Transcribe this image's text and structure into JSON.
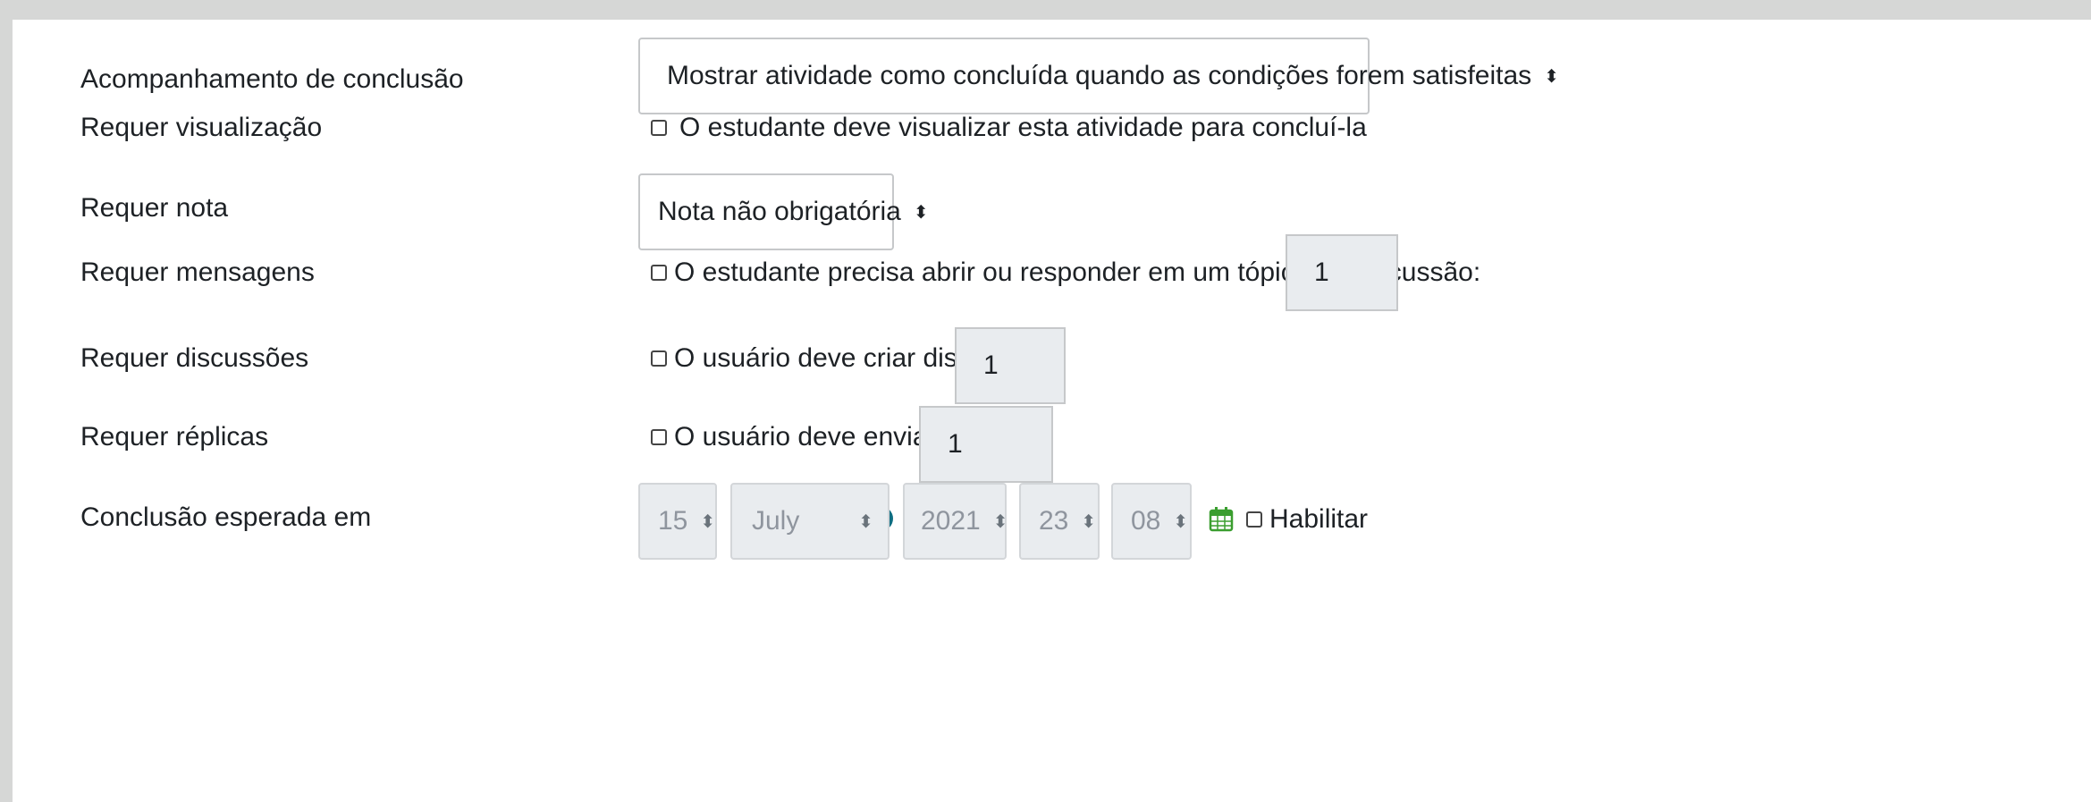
{
  "form": {
    "completion_tracking": {
      "label": "Acompanhamento de conclusão",
      "help_icon": "question-circle-icon",
      "select_value": "Mostrar atividade como concluída quando as condições forem satisfeitas"
    },
    "require_view": {
      "label": "Requer visualização",
      "checkbox_label": "O estudante deve visualizar esta atividade para concluí-la",
      "checked": false
    },
    "require_grade": {
      "label": "Requer nota",
      "select_value": "Nota não obrigatória"
    },
    "require_posts": {
      "label": "Requer mensagens",
      "checkbox_label": "O estudante precisa abrir ou responder em um tópico de discussão:",
      "value": "1",
      "checked": false
    },
    "require_discussions": {
      "label": "Requer discussões",
      "checkbox_label": "O usuário deve criar discussões:",
      "value": "1",
      "checked": false
    },
    "require_replies": {
      "label": "Requer réplicas",
      "checkbox_label": "O usuário deve enviar réplicas:",
      "value": "1",
      "checked": false
    },
    "expected_completion": {
      "label": "Conclusão esperada em",
      "help_icon": "question-circle-icon",
      "day": "15",
      "month": "July",
      "year": "2021",
      "hour": "23",
      "minute": "08",
      "calendar_icon": "calendar-icon",
      "enable_label": "Habilitar",
      "enabled": false
    }
  },
  "colors": {
    "page_background": "#d6d7d6",
    "help_icon": "#0f6e82",
    "calendar_icon": "#3a9e2f",
    "disabled_field": "#e9ecef"
  }
}
